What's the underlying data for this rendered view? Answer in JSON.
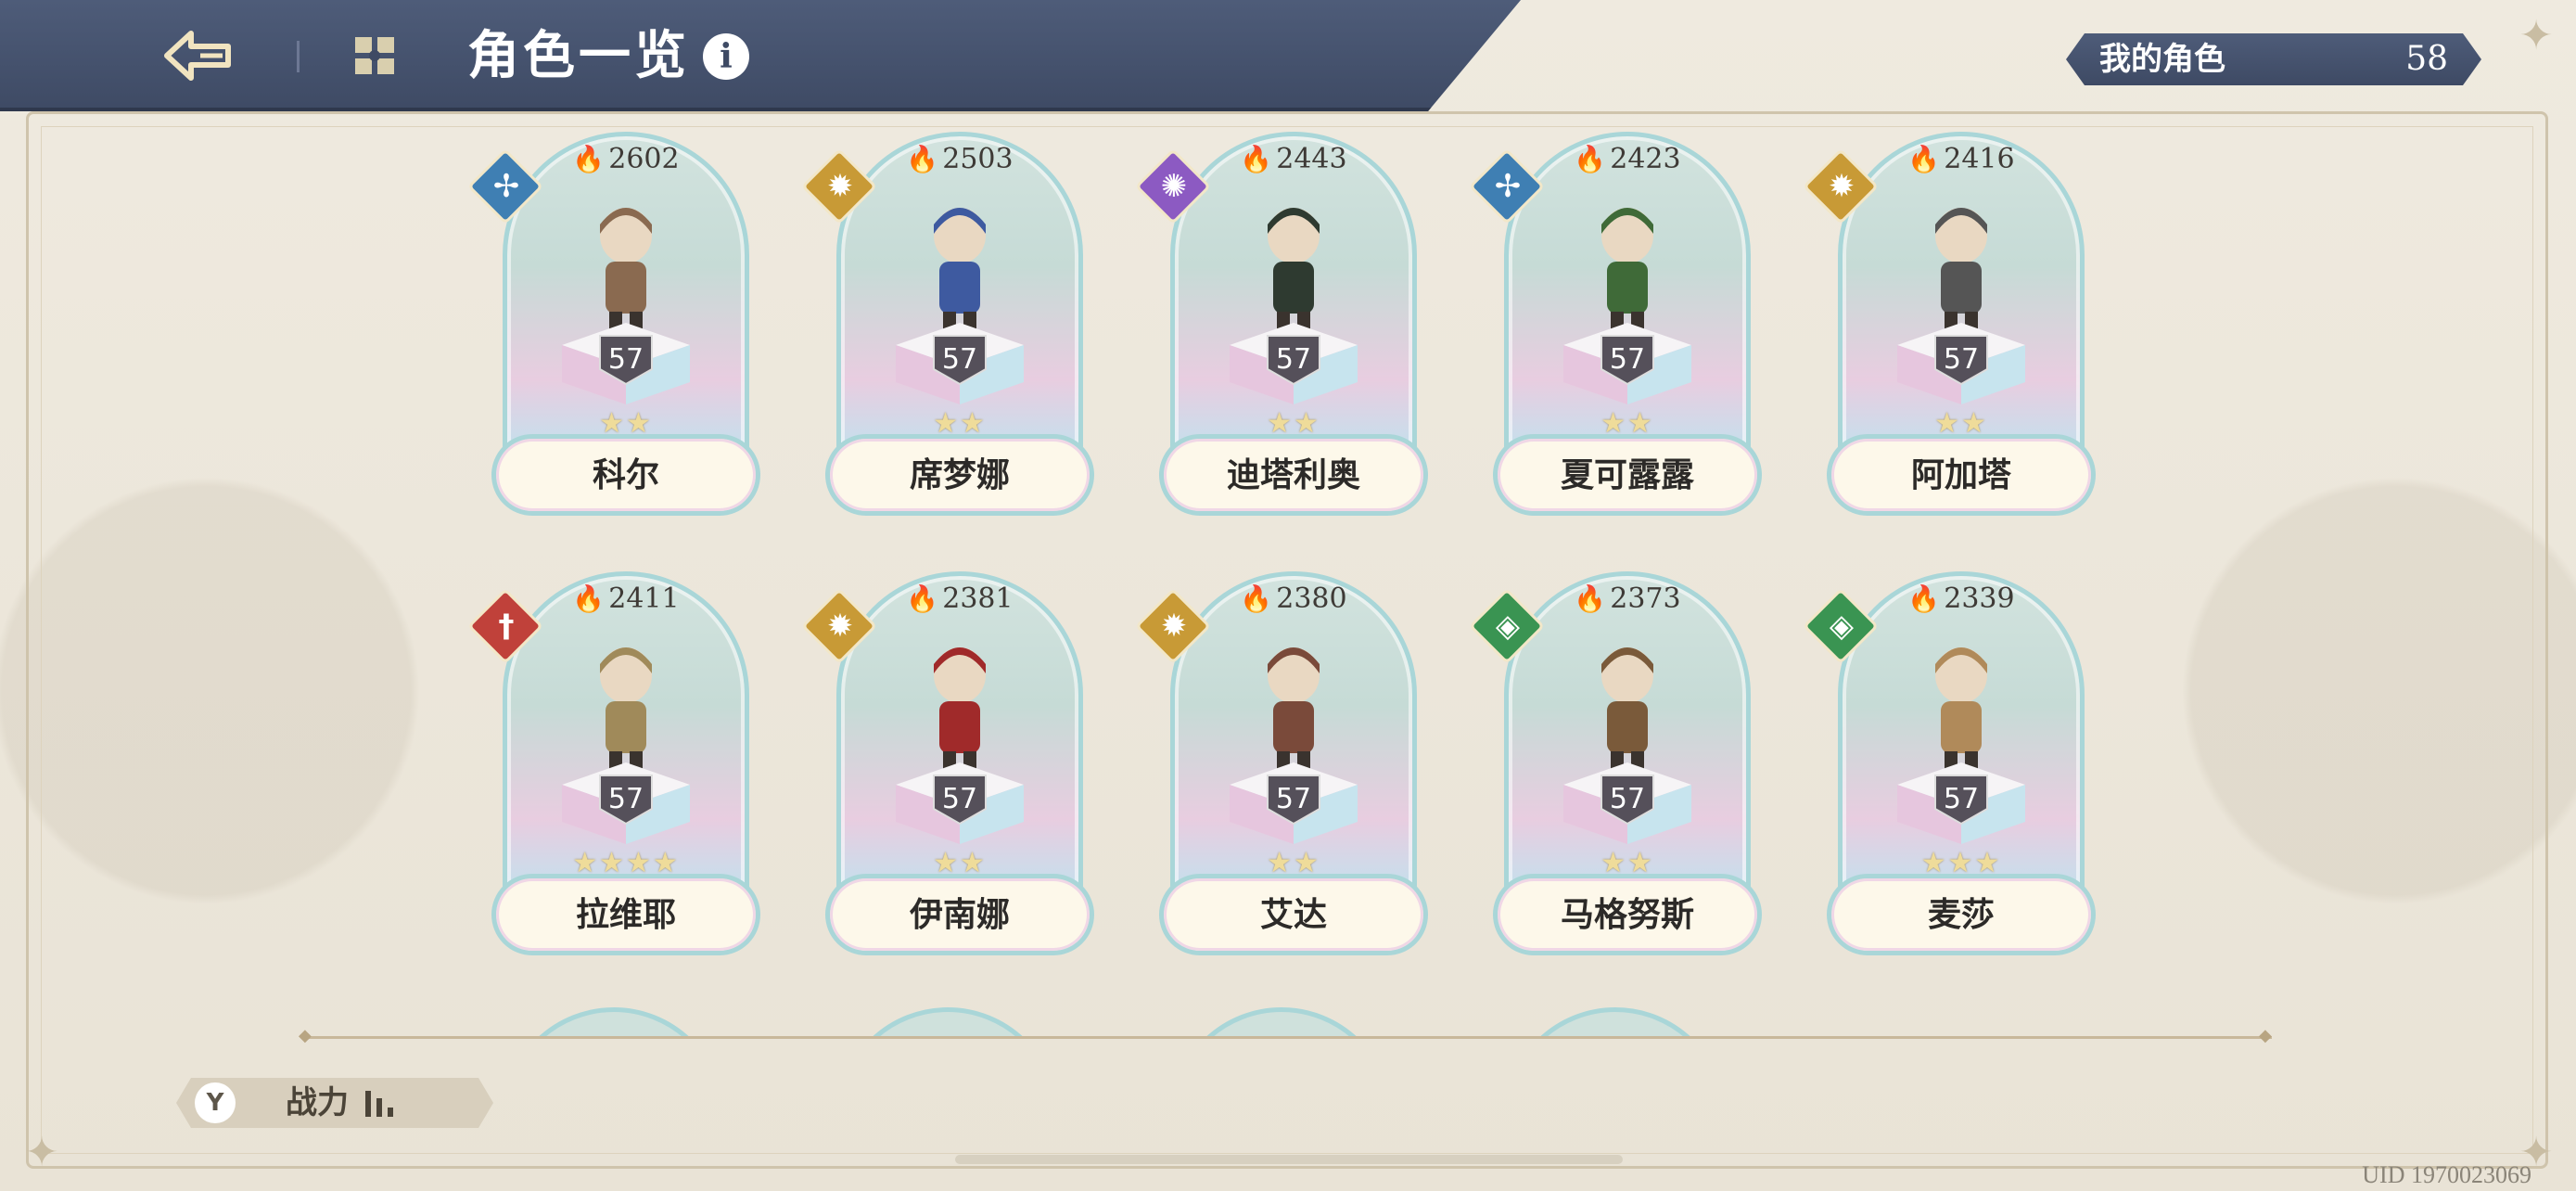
{
  "header": {
    "title": "角色一览",
    "info_label": "i"
  },
  "my_characters": {
    "label": "我的角色",
    "count": "58"
  },
  "characters": [
    {
      "name": "科尔",
      "power": "2602",
      "level": "57",
      "stars": "★★",
      "element": "wind",
      "element_color": "#3f7fb3",
      "sprite_color": "#8a6a50"
    },
    {
      "name": "席梦娜",
      "power": "2503",
      "level": "57",
      "stars": "★★",
      "element": "light",
      "element_color": "#c89a36",
      "sprite_color": "#3e5aa0"
    },
    {
      "name": "迪塔利奥",
      "power": "2443",
      "level": "57",
      "stars": "★★",
      "element": "dark",
      "element_color": "#8c5ac2",
      "sprite_color": "#2e3a30"
    },
    {
      "name": "夏可露露",
      "power": "2423",
      "level": "57",
      "stars": "★★",
      "element": "wind",
      "element_color": "#3f7fb3",
      "sprite_color": "#3f6a38"
    },
    {
      "name": "阿加塔",
      "power": "2416",
      "level": "57",
      "stars": "★★",
      "element": "light",
      "element_color": "#c89a36",
      "sprite_color": "#555555"
    },
    {
      "name": "拉维耶",
      "power": "2411",
      "level": "57",
      "stars": "★★★★",
      "element": "fire",
      "element_color": "#c0413a",
      "sprite_color": "#a08a5a"
    },
    {
      "name": "伊南娜",
      "power": "2381",
      "level": "57",
      "stars": "★★",
      "element": "light",
      "element_color": "#c89a36",
      "sprite_color": "#a02a2a"
    },
    {
      "name": "艾达",
      "power": "2380",
      "level": "57",
      "stars": "★★",
      "element": "light",
      "element_color": "#c89a36",
      "sprite_color": "#7a4a3a"
    },
    {
      "name": "马格努斯",
      "power": "2373",
      "level": "57",
      "stars": "★★",
      "element": "earth",
      "element_color": "#3a9452",
      "sprite_color": "#7a5a3a"
    },
    {
      "name": "麦莎",
      "power": "2339",
      "level": "57",
      "stars": "★★★",
      "element": "earth",
      "element_color": "#3a9452",
      "sprite_color": "#b08a5a"
    }
  ],
  "sort": {
    "label": "战力",
    "icon": "filter-icon"
  },
  "uid_text": "UID 1970023069",
  "colors": {
    "header_bg": "#3e4a64",
    "card_border": "#a9d6d8",
    "fire_icon": "#d9692b"
  }
}
